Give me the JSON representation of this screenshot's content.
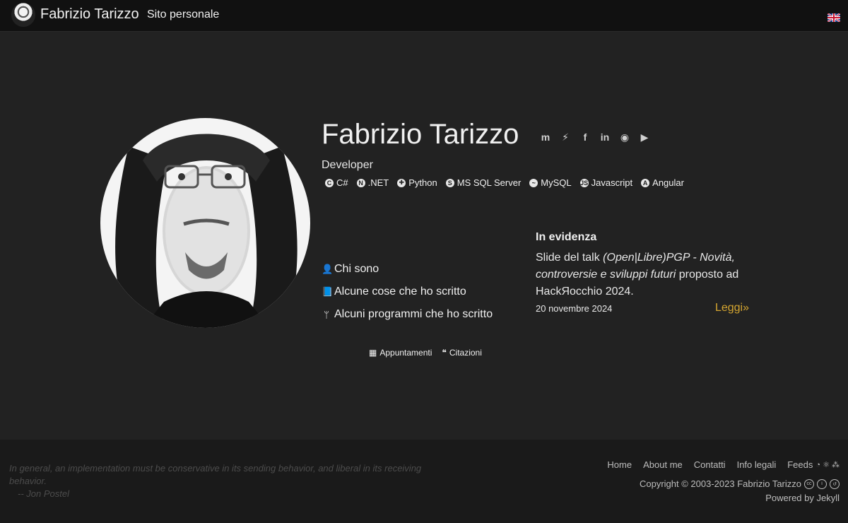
{
  "navbar": {
    "brand": "Fabrizio Tarizzo",
    "tagline": "Sito personale",
    "language_flag": "uk-flag-icon"
  },
  "hero": {
    "name": "Fabrizio Tarizzo",
    "role": "Developer",
    "social": [
      {
        "name": "mastodon-icon",
        "glyph": "m"
      },
      {
        "name": "messenger-icon",
        "glyph": "⚡"
      },
      {
        "name": "facebook-icon",
        "glyph": "f"
      },
      {
        "name": "linkedin-icon",
        "glyph": "in"
      },
      {
        "name": "github-icon",
        "glyph": "◉"
      },
      {
        "name": "youtube-icon",
        "glyph": "▶"
      }
    ],
    "skills": [
      {
        "label": "C#",
        "glyph": "C"
      },
      {
        "label": ".NET",
        "glyph": "N"
      },
      {
        "label": "Python",
        "glyph": "✚"
      },
      {
        "label": "MS SQL Server",
        "glyph": "S"
      },
      {
        "label": "MySQL",
        "glyph": "~"
      },
      {
        "label": "Javascript",
        "glyph": "JS"
      },
      {
        "label": "Angular",
        "glyph": "A"
      }
    ],
    "links": [
      {
        "label": "Chi sono",
        "icon": "user-icon",
        "glyph": "👤"
      },
      {
        "label": "Alcune cose che ho scritto",
        "icon": "book-icon",
        "glyph": "📘"
      },
      {
        "label": "Alcuni programmi che ho scritto",
        "icon": "code-branch-icon",
        "glyph": "ᛘ"
      }
    ],
    "sub_links": [
      {
        "label": "Appuntamenti",
        "icon": "calendar-icon",
        "glyph": "▦"
      },
      {
        "label": "Citazioni",
        "icon": "quote-icon",
        "glyph": "❝"
      }
    ]
  },
  "featured": {
    "heading": "In evidenza",
    "text_prefix": "Slide del talk ",
    "text_em": "(Open|Libre)PGP - Novità, controversie e sviluppi futuri",
    "text_suffix": " proposto ad HackЯocchio 2024.",
    "date": "20 novembre 2024",
    "more": "Leggi»"
  },
  "footer": {
    "quote": "In general, an implementation must be conservative in its sending behavior, and liberal in its receiving behavior.",
    "quote_author": "-- Jon Postel",
    "nav": [
      "Home",
      "About me",
      "Contatti",
      "Info legali",
      "Feeds"
    ],
    "copyright": "Copyright © 2003-2023 Fabrizio Tarizzo",
    "powered": "Powered by Jekyll"
  }
}
